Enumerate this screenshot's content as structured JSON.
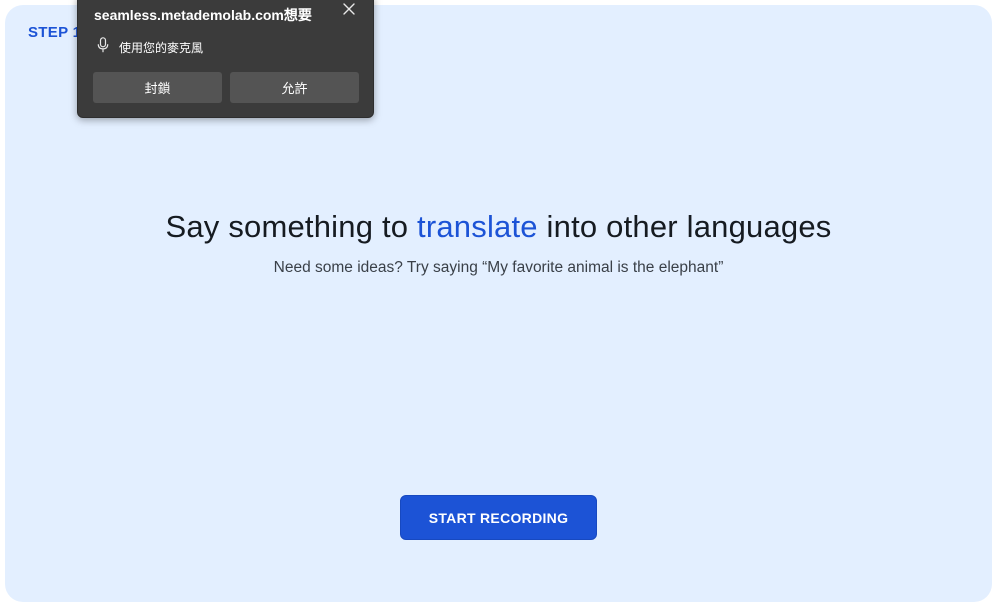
{
  "main": {
    "step_label": "STEP 1",
    "headline_before": "Say something to ",
    "headline_accent": "translate",
    "headline_after": " into other languages",
    "subline": "Need some ideas? Try saying “My favorite animal is the elephant”",
    "start_button": "START RECORDING"
  },
  "permission_popup": {
    "title": "seamless.metademolab.com想要",
    "permission": "使用您的麥克風",
    "block_label": "封鎖",
    "allow_label": "允許",
    "icons": {
      "permission": "microphone-icon",
      "close": "close-icon"
    }
  },
  "colors": {
    "accent": "#1c53d6",
    "card_background": "#e3efff",
    "popup_background": "#3b3b3b",
    "popup_button": "#545454"
  }
}
